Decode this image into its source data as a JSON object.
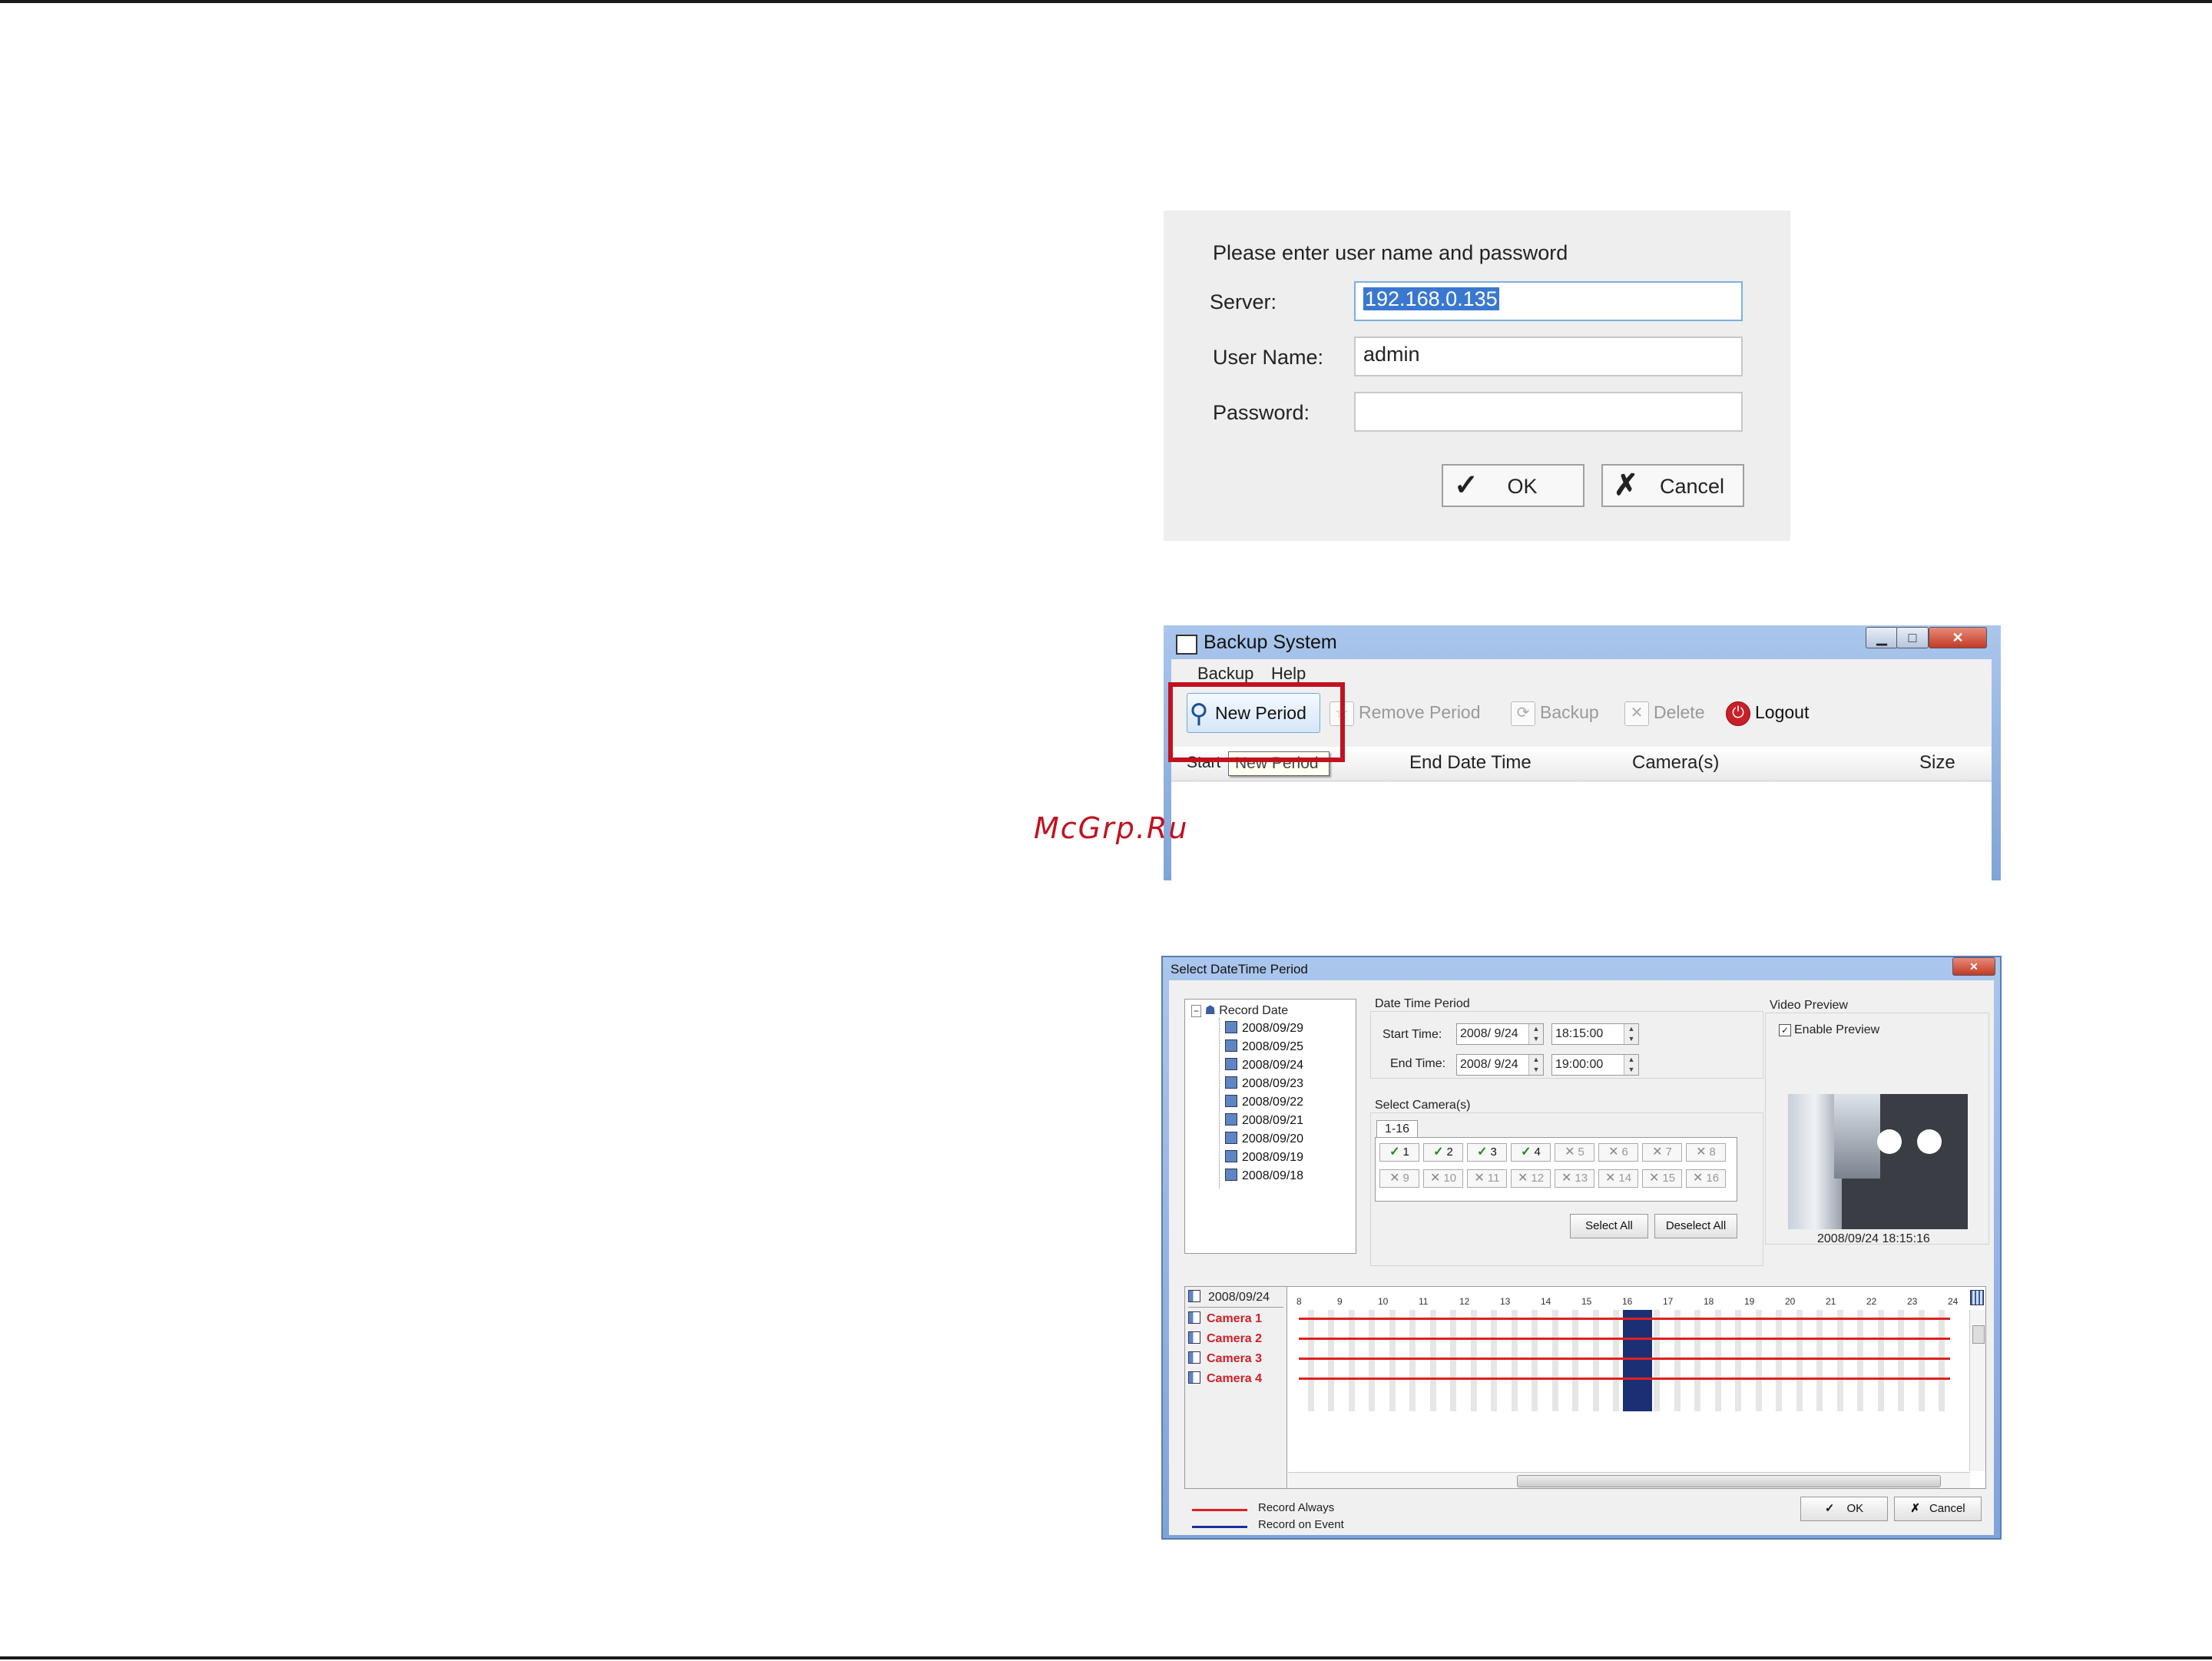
{
  "login": {
    "prompt": "Please enter user name and password",
    "server_label": "Server:",
    "server_value": "192.168.0.135",
    "username_label": "User Name:",
    "username_value": "admin",
    "password_label": "Password:",
    "password_value": "",
    "ok_label": "OK",
    "cancel_label": "Cancel"
  },
  "backup": {
    "title": "Backup System",
    "menu": [
      "Backup",
      "Help"
    ],
    "toolbar": {
      "new_period": "New Period",
      "remove_period": "Remove Period",
      "backup": "Backup",
      "delete": "Delete",
      "logout": "Logout"
    },
    "columns": {
      "start": "Start",
      "end": "End Date Time",
      "cameras": "Camera(s)",
      "size": "Size"
    },
    "tooltip": "New Period"
  },
  "watermark": "McGrp.Ru",
  "sdp": {
    "title": "Select DateTime Period",
    "tree_root": "Record Date",
    "dates": [
      "2008/09/29",
      "2008/09/25",
      "2008/09/24",
      "2008/09/23",
      "2008/09/22",
      "2008/09/21",
      "2008/09/20",
      "2008/09/19",
      "2008/09/18"
    ],
    "period_title": "Date Time Period",
    "start_label": "Start Time:",
    "start_date": "2008/  9/24",
    "start_time": "18:15:00",
    "end_label": "End Time:",
    "end_date": "2008/  9/24",
    "end_time": "19:00:00",
    "select_cameras_title": "Select Camera(s)",
    "tab_label": "1-16",
    "cameras": [
      {
        "n": "1",
        "on": true
      },
      {
        "n": "2",
        "on": true
      },
      {
        "n": "3",
        "on": true
      },
      {
        "n": "4",
        "on": true
      },
      {
        "n": "5",
        "on": false
      },
      {
        "n": "6",
        "on": false
      },
      {
        "n": "7",
        "on": false
      },
      {
        "n": "8",
        "on": false
      },
      {
        "n": "9",
        "on": false
      },
      {
        "n": "10",
        "on": false
      },
      {
        "n": "11",
        "on": false
      },
      {
        "n": "12",
        "on": false
      },
      {
        "n": "13",
        "on": false
      },
      {
        "n": "14",
        "on": false
      },
      {
        "n": "15",
        "on": false
      },
      {
        "n": "16",
        "on": false
      }
    ],
    "select_all": "Select All",
    "deselect_all": "Deselect All",
    "video_preview_title": "Video Preview",
    "enable_preview": "Enable Preview",
    "preview_timestamp": "2008/09/24 18:15:16",
    "timeline_date": "2008/09/24",
    "hours": [
      "8",
      "9",
      "10",
      "11",
      "12",
      "13",
      "14",
      "15",
      "16",
      "17",
      "18",
      "19",
      "20",
      "21",
      "22",
      "23",
      "24"
    ],
    "camera_rows": [
      "Camera 1",
      "Camera 2",
      "Camera 3",
      "Camera 4"
    ],
    "legend_always": "Record Always",
    "legend_event": "Record on Event",
    "ok_label": "OK",
    "cancel_label": "Cancel",
    "colors": {
      "always": "#e02020",
      "event": "#1c2f9a"
    }
  }
}
